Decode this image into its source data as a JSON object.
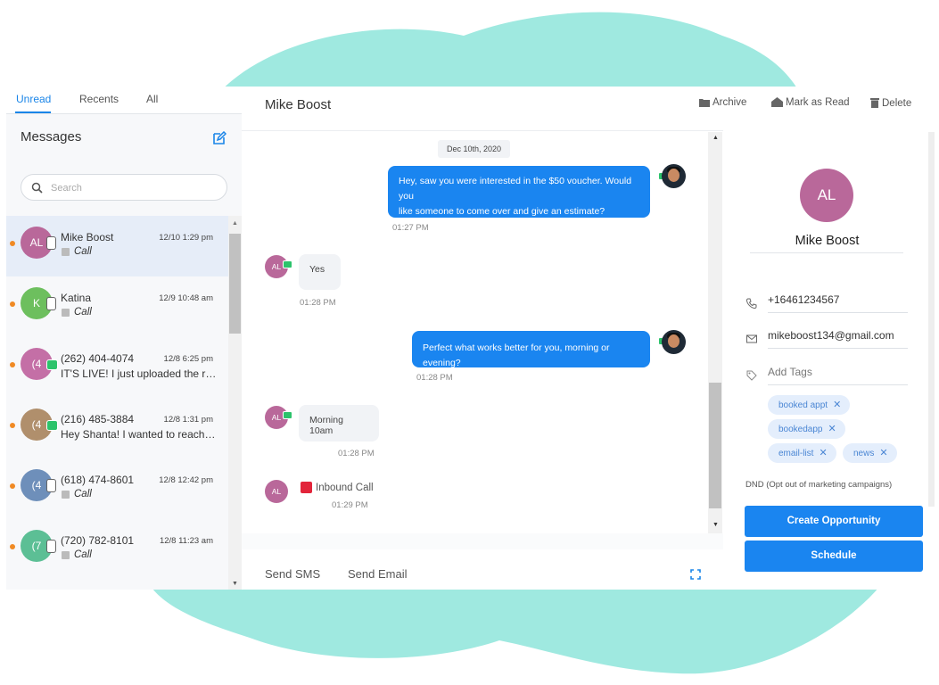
{
  "tabs": [
    "Unread",
    "Recents",
    "All"
  ],
  "messages_title": "Messages",
  "search_placeholder": "Search",
  "conversations": [
    {
      "initials": "AL",
      "name": "Mike Boost",
      "time": "12/10 1:29 pm",
      "subtitle": "Call",
      "type": "call",
      "color": "#b9689a"
    },
    {
      "initials": "K",
      "name": "Katina",
      "time": "12/9 10:48 am",
      "subtitle": "Call",
      "type": "call",
      "color": "#6dbf5e"
    },
    {
      "initials": "(4",
      "name": "(262) 404-4074",
      "time": "12/8 6:25 pm",
      "subtitle": "IT'S LIVE! I just uploaded the re...",
      "type": "sms",
      "color": "#c46fa6"
    },
    {
      "initials": "(4",
      "name": "(216) 485-3884",
      "time": "12/8 1:31 pm",
      "subtitle": "Hey Shanta! I wanted to reach o...",
      "type": "sms",
      "color": "#b08f6c"
    },
    {
      "initials": "(4",
      "name": "(618) 474-8601",
      "time": "12/8 12:42 pm",
      "subtitle": "Call",
      "type": "call",
      "color": "#6e8fba"
    },
    {
      "initials": "(7",
      "name": "(720) 782-8101",
      "time": "12/8 11:23 am",
      "subtitle": "Call",
      "type": "call",
      "color": "#5cbf95"
    }
  ],
  "header": {
    "contact_name": "Mike Boost",
    "archive": "Archive",
    "mark_read": "Mark as Read",
    "delete": "Delete"
  },
  "thread": {
    "date": "Dec 10th, 2020",
    "msg1": {
      "line1": "Hey, saw you were interested in the $50 voucher. Would you",
      "line2": "like someone to come over and give an estimate?",
      "time": "01:27 PM"
    },
    "msg2": {
      "avatar": "AL",
      "text": "Yes",
      "time": "01:28 PM"
    },
    "msg3": {
      "text": "Perfect what works better for you, morning or evening?",
      "time": "01:28 PM"
    },
    "msg4": {
      "avatar": "AL",
      "text": "Morning 10am",
      "time": "01:28 PM"
    },
    "call": {
      "avatar": "AL",
      "text": "Inbound Call",
      "time": "01:29 PM"
    }
  },
  "composer": {
    "send_sms": "Send SMS",
    "send_email": "Send Email"
  },
  "contact": {
    "initials": "AL",
    "name": "Mike Boost",
    "phone": "+16461234567",
    "email": "mikeboost134@gmail.com",
    "tags_placeholder": "Add Tags",
    "tags": [
      "booked appt",
      "bookedapp",
      "email-list",
      "news"
    ],
    "dnd_label": "DND (Opt out of marketing campaigns)",
    "create_opportunity": "Create Opportunity",
    "schedule": "Schedule"
  },
  "colors": {
    "accent": "#1a85f0",
    "backdrop": "#9fe9e0",
    "avatar": "#b9689a",
    "unread_dot": "#f08a24"
  }
}
